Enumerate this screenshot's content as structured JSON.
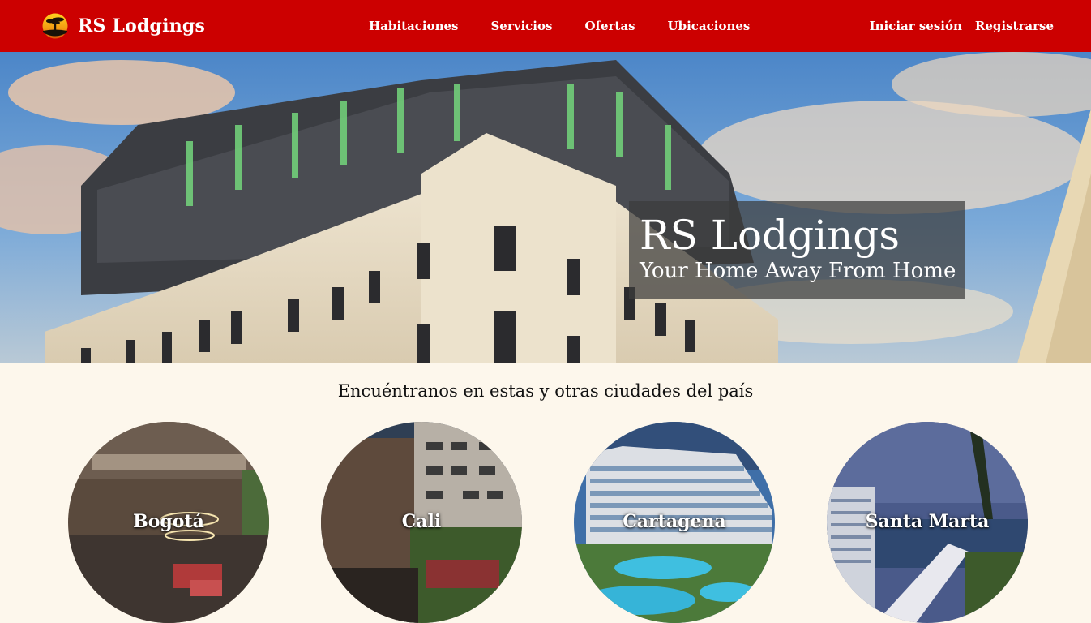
{
  "navbar": {
    "brand": "RS Lodgings",
    "links": [
      "Habitaciones",
      "Servicios",
      "Ofertas",
      "Ubicaciones"
    ],
    "login": "Iniciar sesión",
    "register": "Registrarse",
    "bg_color": "#cc0000",
    "logo_icon": "sunset-tree-logo"
  },
  "hero": {
    "title": "RS Lodgings",
    "subtitle": "Your Home Away From Home"
  },
  "locations": {
    "title": "Encuéntranos en estas y otras ciudades del país",
    "cities": [
      "Bogotá",
      "Cali",
      "Cartagena",
      "Santa Marta"
    ]
  }
}
